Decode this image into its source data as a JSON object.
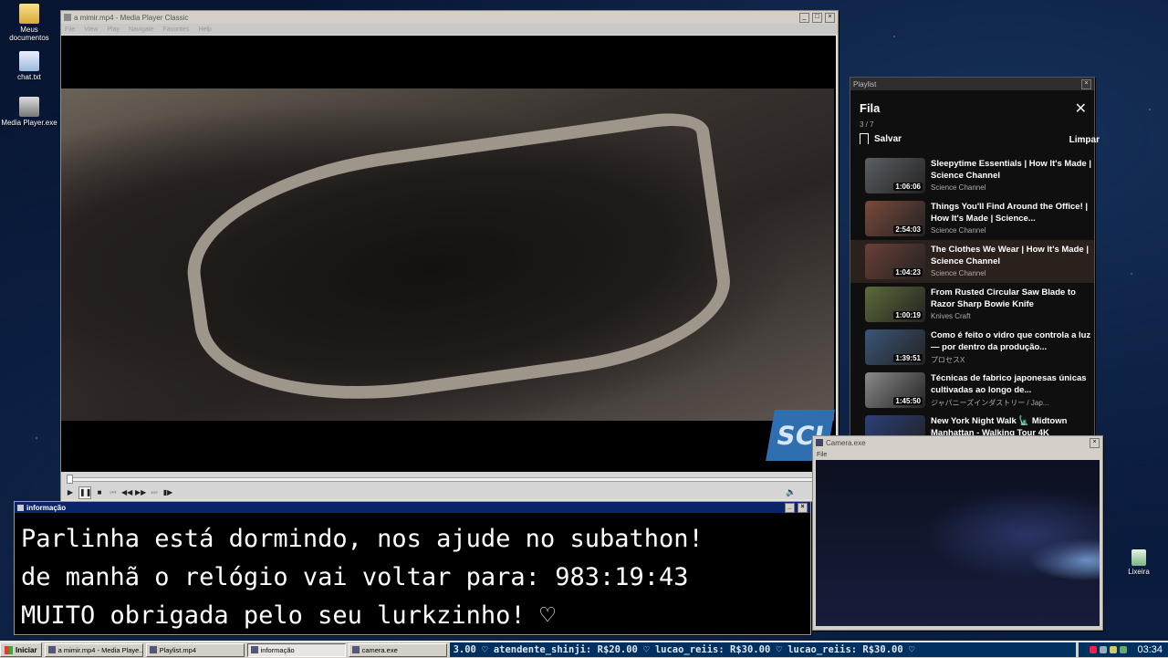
{
  "desktop_icons": [
    {
      "label": "Meus documentos",
      "icon": "folder-icon"
    },
    {
      "label": "chat.txt",
      "icon": "text-file-icon"
    },
    {
      "label": "Media Player.exe",
      "icon": "media-player-icon"
    }
  ],
  "media_player": {
    "title": "a mimir.mp4 - Media Player Classic",
    "menu": [
      "File",
      "View",
      "Play",
      "Navigate",
      "Favorites",
      "Help"
    ],
    "logo_text": "SCI",
    "progress": 0.0
  },
  "playlist": {
    "window_title": "Playlist",
    "heading": "Fila",
    "position": "3 / 7",
    "save_label": "Salvar",
    "clear_label": "Limpar",
    "items": [
      {
        "title": "Sleepytime Essentials | How It's Made | Science Channel",
        "channel": "Science Channel",
        "duration": "1:06:06",
        "thumb": "#5b5f63"
      },
      {
        "title": "Things You'll Find Around the Office! | How It's Made | Science...",
        "channel": "Science Channel",
        "duration": "2:54:03",
        "thumb": "#7a4a3a"
      },
      {
        "title": "The Clothes We Wear | How It's Made | Science Channel",
        "channel": "Science Channel",
        "duration": "1:04:23",
        "thumb": "#6b3f36",
        "active": true
      },
      {
        "title": "From Rusted Circular Saw Blade to Razor Sharp Bowie Knife",
        "channel": "Knives Craft",
        "duration": "1:00:19",
        "thumb": "#5d6b3a"
      },
      {
        "title": "Como é feito o vidro que controla a luz — por dentro da produção...",
        "channel": "プロセスX",
        "duration": "1:39:51",
        "thumb": "#3a5678"
      },
      {
        "title": "Técnicas de fabrico japonesas únicas cultivadas ao longo de...",
        "channel": "ジャパニーズインダストリー / Jap...",
        "duration": "1:45:50",
        "thumb": "#8a8a8a"
      },
      {
        "title": "New York Night Walk 🗽 Midtown Manhattan - Walking Tour 4K",
        "channel": "",
        "duration": "",
        "thumb": "#2b3f7a"
      }
    ]
  },
  "info": {
    "title": "informação",
    "lines": [
      "Parlinha está dormindo, nos ajude no subathon!",
      "de manhã o relógio vai voltar para:  983:19:43",
      "MUITO obrigada pelo seu lurkzinho! ♡"
    ]
  },
  "camera": {
    "title": "Camera.exe",
    "menu": [
      "File"
    ]
  },
  "recycle": {
    "label": "Lixeira"
  },
  "taskbar": {
    "start_label": "Iniciar",
    "tasks": [
      {
        "label": "a mimir.mp4 - Media Playe...",
        "pressed": false
      },
      {
        "label": "Playlist.mp4",
        "pressed": false
      },
      {
        "label": "informação",
        "pressed": true
      },
      {
        "label": "camera.exe",
        "pressed": false
      }
    ],
    "ticker": "3.00 ♡  atendente_shinji: R$20.00 ♡  lucao_reiis: R$30.00 ♡  lucao_reiis: R$30.00 ♡",
    "clock": "03:34"
  },
  "colors": {
    "info_title": "#0a246a",
    "ticker_bg": "#003060",
    "active_item": "#2a211d"
  }
}
